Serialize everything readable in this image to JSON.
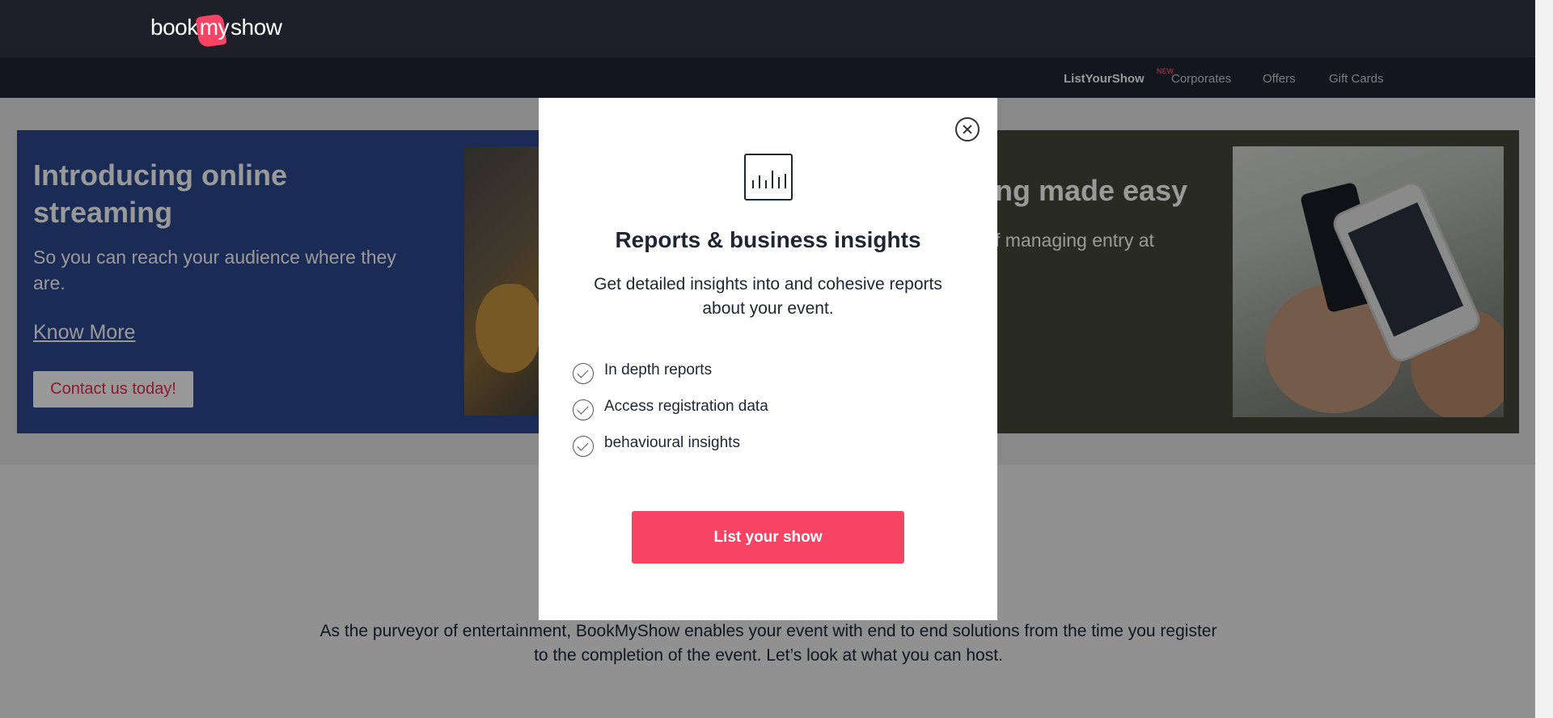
{
  "header": {
    "logo": {
      "part1": "book",
      "part2": "my",
      "part3": "show"
    },
    "nav": [
      {
        "label": "ListYourShow"
      },
      {
        "label": "Corporates"
      },
      {
        "label": "Offers"
      },
      {
        "label": "Gift Cards"
      }
    ],
    "new_badge": "NEW"
  },
  "banner_left": {
    "title": "Introducing online streaming",
    "subtitle": "So you can reach your audience where they are.",
    "link": "Know More",
    "button": "Contact us today!"
  },
  "banner_right": {
    "title": "ng made easy",
    "subtitle": "f managing entry at"
  },
  "intro_text": "As the purveyor of entertainment, BookMyShow enables your event with end to end solutions from the time you register to the completion of the event. Let’s look at what you can host.",
  "modal": {
    "title": "Reports & business insights",
    "description": "Get detailed insights into and cohesive reports about your event.",
    "features": [
      "In depth reports",
      "Access registration data",
      "behavioural insights"
    ],
    "cta": "List your show",
    "icon": "report-chart-icon",
    "close_icon": "close-icon"
  },
  "colors": {
    "brand": "#f84464",
    "header_bg": "#333545",
    "nav_bg": "#1f2533"
  }
}
